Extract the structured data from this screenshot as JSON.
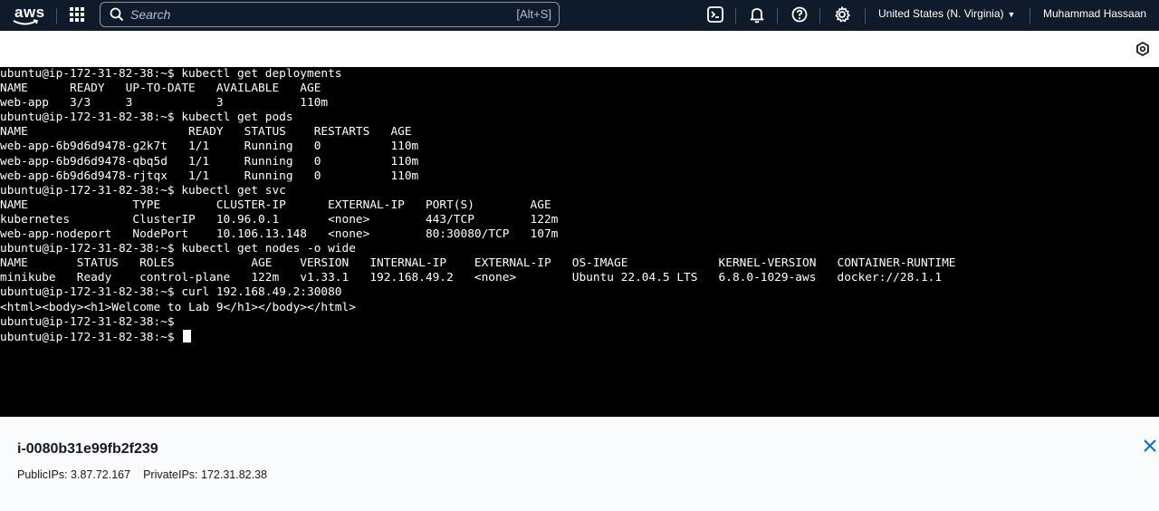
{
  "nav": {
    "logo_text": "aws",
    "search_placeholder": "Search",
    "search_shortcut": "[Alt+S]",
    "icons": [
      "apps-grid-icon",
      "search-icon",
      "cloudshell-icon",
      "bell-icon",
      "help-icon",
      "gear-icon"
    ],
    "region": "United States (N. Virginia)",
    "user": "Muhammad Hassaan"
  },
  "terminal": {
    "lines": [
      "ubuntu@ip-172-31-82-38:~$ kubectl get deployments",
      "NAME      READY   UP-TO-DATE   AVAILABLE   AGE",
      "web-app   3/3     3            3           110m",
      "ubuntu@ip-172-31-82-38:~$ kubectl get pods",
      "NAME                       READY   STATUS    RESTARTS   AGE",
      "web-app-6b9d6d9478-g2k7t   1/1     Running   0          110m",
      "web-app-6b9d6d9478-qbq5d   1/1     Running   0          110m",
      "web-app-6b9d6d9478-rjtqx   1/1     Running   0          110m",
      "ubuntu@ip-172-31-82-38:~$ kubectl get svc",
      "NAME               TYPE        CLUSTER-IP      EXTERNAL-IP   PORT(S)        AGE",
      "kubernetes         ClusterIP   10.96.0.1       <none>        443/TCP        122m",
      "web-app-nodeport   NodePort    10.106.13.148   <none>        80:30080/TCP   107m",
      "ubuntu@ip-172-31-82-38:~$ kubectl get nodes -o wide",
      "NAME       STATUS   ROLES           AGE    VERSION   INTERNAL-IP    EXTERNAL-IP   OS-IMAGE             KERNEL-VERSION   CONTAINER-RUNTIME",
      "minikube   Ready    control-plane   122m   v1.33.1   192.168.49.2   <none>        Ubuntu 22.04.5 LTS   6.8.0-1029-aws   docker://28.1.1",
      "ubuntu@ip-172-31-82-38:~$ curl 192.168.49.2:30080",
      "<html><body><h1>Welcome to Lab 9</h1></body></html>",
      "ubuntu@ip-172-31-82-38:~$",
      "ubuntu@ip-172-31-82-38:~$ "
    ]
  },
  "instance": {
    "id": "i-0080b31e99fb2f239",
    "public_ips": "PublicIPs: 3.87.72.167",
    "private_ips": "PrivateIPs: 172.31.82.38"
  }
}
